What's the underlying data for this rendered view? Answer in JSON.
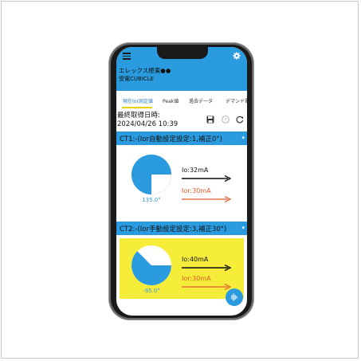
{
  "app": {
    "title_line1": "エレックス極東●●",
    "title_line2": "受電CUBICLE"
  },
  "tabs": [
    {
      "label": "現在Ior測定値",
      "active": true
    },
    {
      "label": "Peak値",
      "active": false
    },
    {
      "label": "過去データ",
      "active": false
    },
    {
      "label": "デマンド電",
      "active": false
    }
  ],
  "status": {
    "last_fetch_label": "最終取得日時:",
    "last_fetch_value": "2024/04/26 10:39"
  },
  "icons": {
    "menu": "menu-icon",
    "settings": "gear-icon",
    "save": "save-icon",
    "help": "help-icon",
    "refresh": "refresh-icon",
    "fab": "audio-wave-icon"
  },
  "sections": [
    {
      "header": "CT1:-(Ior自動設定設定:1,補正0°)",
      "angle_label": "135.0°",
      "io_label": "Io:32mA",
      "ior_label": "Ior:30mA",
      "card_color": "#ffffff"
    },
    {
      "header": "CT2:-(Ior手動設定設定:3,補正30°)",
      "angle_label": "-95.0°",
      "io_label": "Io:40mA",
      "ior_label": "Ior:30mA",
      "card_color": "#f6ec3a"
    }
  ],
  "colors": {
    "accent": "#2b9be0",
    "ior_arrow": "#e25a2b",
    "highlight_card": "#f6ec3a",
    "tab_indicator": "#e8d200"
  }
}
